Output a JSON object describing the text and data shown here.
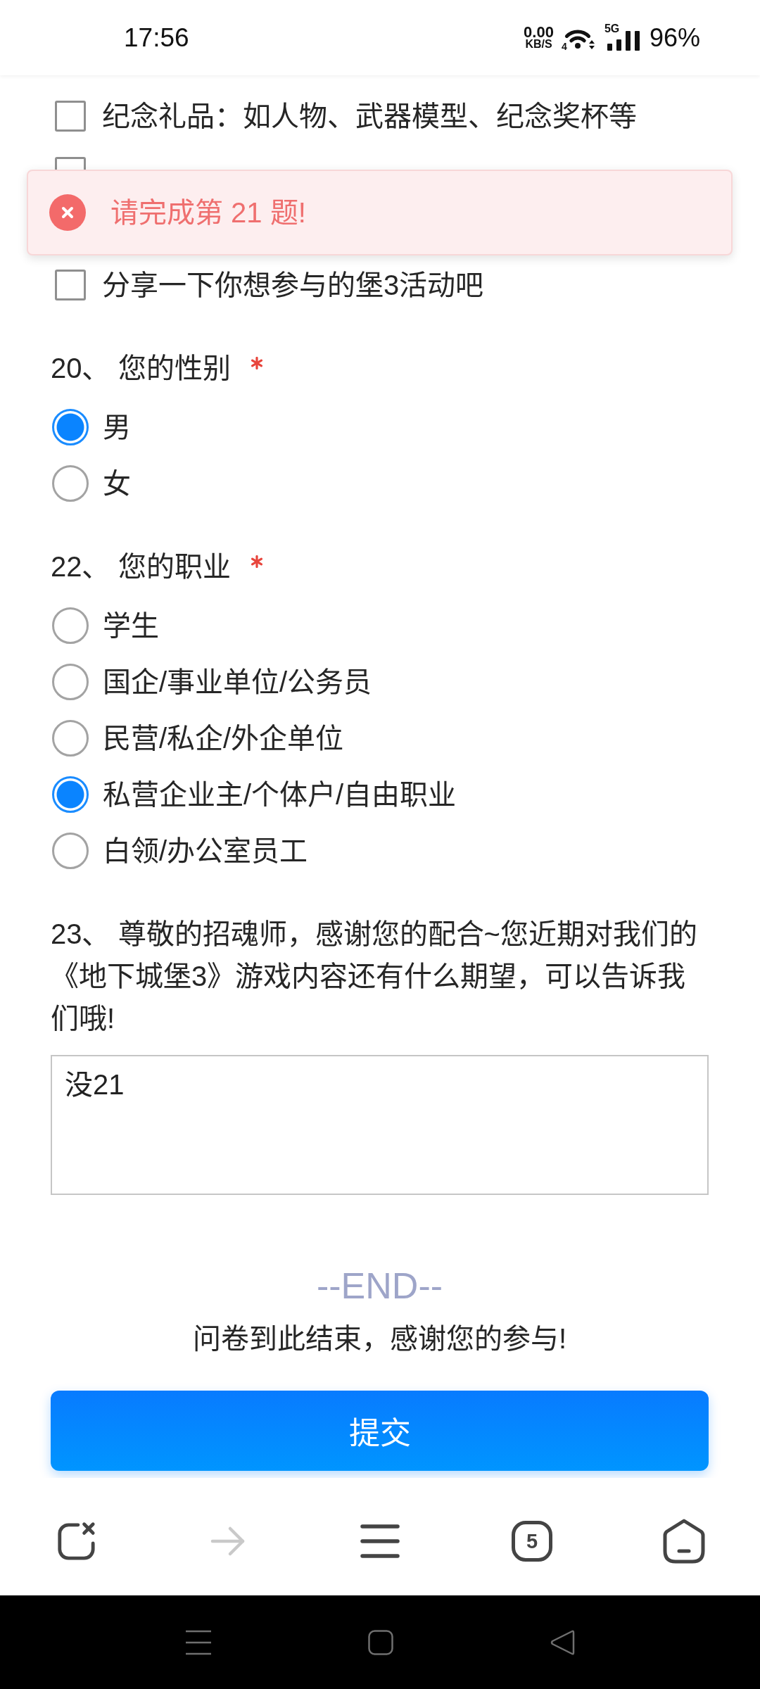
{
  "status_bar": {
    "time": "17:56",
    "net_speed": "0.00",
    "net_speed_unit": "KB/S",
    "wifi_label": "4",
    "network_type": "5G",
    "battery": "96%"
  },
  "questions": [
    {
      "kind": "checkbox",
      "options": [
        {
          "label": "纪念礼品：如人物、武器模型、纪念奖杯等",
          "checked": false
        },
        {
          "checked": false
        },
        {
          "label": "分享一下你想参与的堡3活动吧",
          "checked": false
        }
      ]
    },
    {
      "kind": "radio",
      "title": "20、 您的性别",
      "required": true,
      "options": [
        {
          "label": "男",
          "selected": true
        },
        {
          "label": "女",
          "selected": false
        }
      ]
    },
    {
      "kind": "radio",
      "title": "22、 您的职业",
      "required": true,
      "options": [
        {
          "label": "学生",
          "selected": false
        },
        {
          "label": "国企/事业单位/公务员",
          "selected": false
        },
        {
          "label": "民营/私企/外企单位",
          "selected": false
        },
        {
          "label": "私营企业主/个体户/自由职业",
          "selected": true
        },
        {
          "label": "白领/办公室员工",
          "selected": false
        }
      ]
    },
    {
      "kind": "text",
      "title": "23、 尊敬的招魂师，感谢您的配合~您近期对我们的《地下城堡3》游戏内容还有什么期望，可以告诉我们哦!",
      "value": "没21"
    }
  ],
  "toast": {
    "kind": "error",
    "message": "请完成第 21 题!"
  },
  "end": {
    "marker": "--END--",
    "message": "问卷到此结束，感谢您的参与!"
  },
  "submit_button": {
    "label": "提交"
  },
  "browser_toolbar": {
    "forward_disabled": true,
    "tab_count": "5"
  }
}
